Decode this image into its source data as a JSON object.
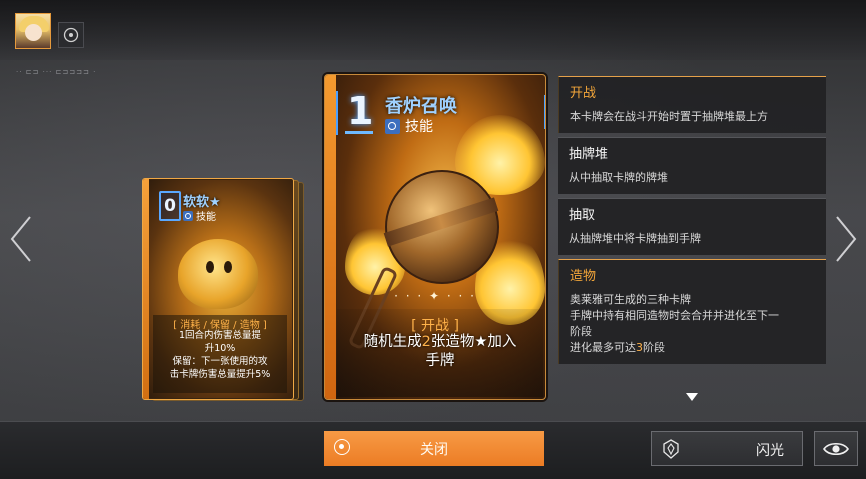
{
  "header": {
    "avatar_icon": "character-portrait",
    "target_icon": "target-icon",
    "debug_text": "·· ⊏⊐ ··· ⊏⊐⊐⊐⊐ ·"
  },
  "small_card": {
    "cost": "0",
    "name": "软软★",
    "type": "技能",
    "tags": "[ 消耗 / 保留 / 造物 ]",
    "desc_1": "1回合内伤害总量提",
    "desc_2": "升10%",
    "desc_3": "保留：下一张使用的攻",
    "desc_4": "击卡牌伤害总量提升5%"
  },
  "big_card": {
    "cost": "1",
    "name": "香炉召唤",
    "type": "技能",
    "sparkle": "· · · ✦ · · ·",
    "tag": "[ 开战 ]",
    "desc_prefix": "随机生成",
    "desc_highlight": "2",
    "desc_suffix": "张造物★加入",
    "desc_line2": "手牌"
  },
  "keywords": [
    {
      "title": "开战",
      "desc": "本卡牌会在战斗开始时置于抽牌堆最上方",
      "style": "gold"
    },
    {
      "title": "抽牌堆",
      "desc": "从中抽取卡牌的牌堆",
      "style": "white"
    },
    {
      "title": "抽取",
      "desc": "从抽牌堆中将卡牌抽到手牌",
      "style": "white"
    },
    {
      "title": "造物",
      "desc_1": "奥莱雅可生成的三种卡牌",
      "desc_2": "手牌中持有相同造物时会合并并进化至下一",
      "desc_3": "阶段",
      "desc_4_prefix": "进化最多可达",
      "desc_4_highlight": "3",
      "desc_4_suffix": "阶段",
      "style": "gold"
    }
  ],
  "buttons": {
    "close_label": "关闭",
    "flash_label": "闪光",
    "eye_icon": "eye-icon",
    "flash_icon": "flash-badge-icon"
  },
  "colors": {
    "accent_orange": "#ec7c24",
    "keyword_gold": "#f3a63a",
    "cost_blue": "#9fd1ff",
    "highlight": "#ffb24a"
  }
}
